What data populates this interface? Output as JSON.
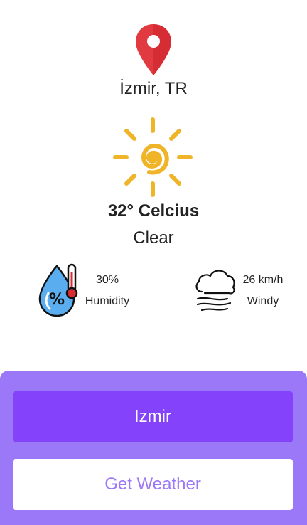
{
  "location": {
    "city": "İzmir, TR",
    "icon": "location-pin-icon"
  },
  "weather": {
    "icon": "sun-icon",
    "temperature": "32° Celcius",
    "condition": "Clear"
  },
  "humidity": {
    "icon": "humidity-drop-icon",
    "value": "30%",
    "label": "Humidity"
  },
  "wind": {
    "icon": "wind-cloud-icon",
    "value": "26 km/h",
    "label": "Windy"
  },
  "form": {
    "city_value": "Izmir",
    "button_label": "Get Weather"
  },
  "colors": {
    "pin": "#d62c34",
    "sun": "#f0b429",
    "panel": "#9b78f7",
    "input": "#8442fa",
    "drop": "#5aaef0"
  }
}
